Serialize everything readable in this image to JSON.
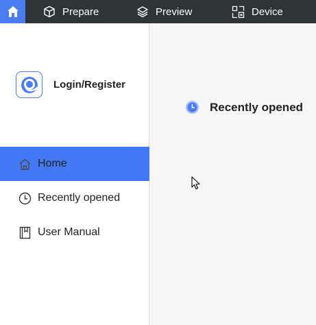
{
  "topbar": {
    "home_icon": "home-icon",
    "tabs": [
      {
        "label": "Prepare",
        "icon": "cube-icon"
      },
      {
        "label": "Preview",
        "icon": "layers-icon"
      },
      {
        "label": "Device",
        "icon": "device-icon"
      }
    ]
  },
  "sidebar": {
    "account_label": "Login/Register",
    "items": [
      {
        "label": "Home",
        "icon": "home-icon",
        "selected": true
      },
      {
        "label": "Recently opened",
        "icon": "clock-icon",
        "selected": false
      },
      {
        "label": "User Manual",
        "icon": "book-icon",
        "selected": false
      }
    ]
  },
  "main": {
    "section_title": "Recently opened"
  },
  "colors": {
    "accent": "#4479f6",
    "topbar_bg": "#2f3436",
    "sidebar_bg": "#ffffff",
    "main_bg": "#f6f6f6"
  }
}
